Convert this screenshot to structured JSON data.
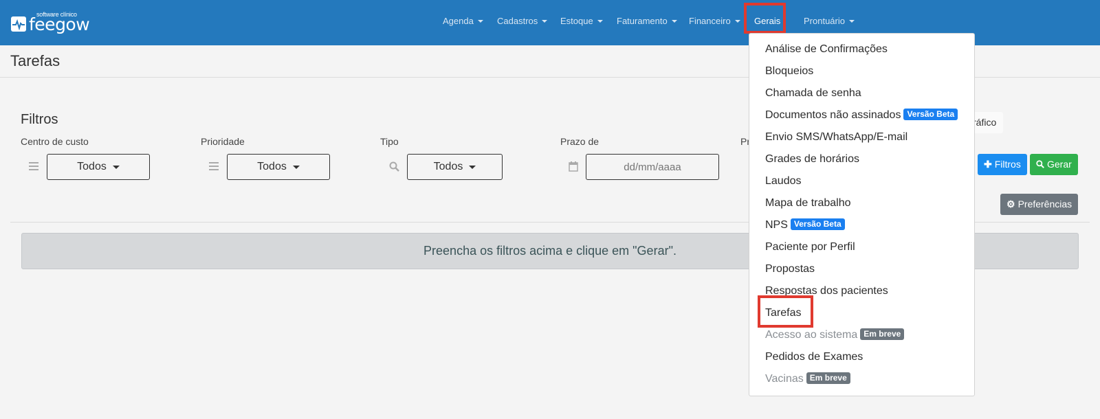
{
  "brand": {
    "name": "feegow",
    "tagline": "software clínico"
  },
  "nav": {
    "items": [
      {
        "label": "Agenda"
      },
      {
        "label": "Cadastros"
      },
      {
        "label": "Estoque"
      },
      {
        "label": "Faturamento"
      },
      {
        "label": "Financeiro"
      },
      {
        "label": "Gerais"
      },
      {
        "label": "Prontuário"
      }
    ]
  },
  "page": {
    "title": "Tarefas"
  },
  "filters": {
    "title": "Filtros",
    "centro_custo": {
      "label": "Centro de custo",
      "value": "Todos"
    },
    "prioridade": {
      "label": "Prioridade",
      "value": "Todos"
    },
    "tipo": {
      "label": "Tipo",
      "value": "Todos"
    },
    "prazo": {
      "label": "Prazo de",
      "placeholder": "dd/mm/aaaa"
    },
    "partial_label": "Pr"
  },
  "actions": {
    "chart_partial": "ráfico",
    "filtros": "Filtros",
    "gerar": "Gerar",
    "preferencias": "Preferências"
  },
  "info_message": "Preencha os filtros acima e clique em \"Gerar\".",
  "dropdown": {
    "items": [
      {
        "label": "Análise de Confirmações"
      },
      {
        "label": "Bloqueios"
      },
      {
        "label": "Chamada de senha"
      },
      {
        "label": "Documentos não assinados",
        "badge": "Versão Beta"
      },
      {
        "label": "Envio SMS/WhatsApp/E-mail"
      },
      {
        "label": "Grades de horários"
      },
      {
        "label": "Laudos"
      },
      {
        "label": "Mapa de trabalho"
      },
      {
        "label": "NPS",
        "badge": "Versão Beta"
      },
      {
        "label": "Paciente por Perfil"
      },
      {
        "label": "Propostas"
      },
      {
        "label": "Respostas dos pacientes"
      },
      {
        "label": "Tarefas"
      },
      {
        "label": "Acesso ao sistema",
        "badge": "Em breve"
      },
      {
        "label": "Pedidos de Exames"
      },
      {
        "label": "Vacinas",
        "badge": "Em breve"
      }
    ]
  },
  "colors": {
    "navbar": "#2479bd",
    "highlight": "#e03a2f",
    "beta_badge": "#1a7ff0",
    "soon_badge": "#6c757d",
    "gerar": "#30b04d",
    "filtros": "#1a8df0"
  }
}
